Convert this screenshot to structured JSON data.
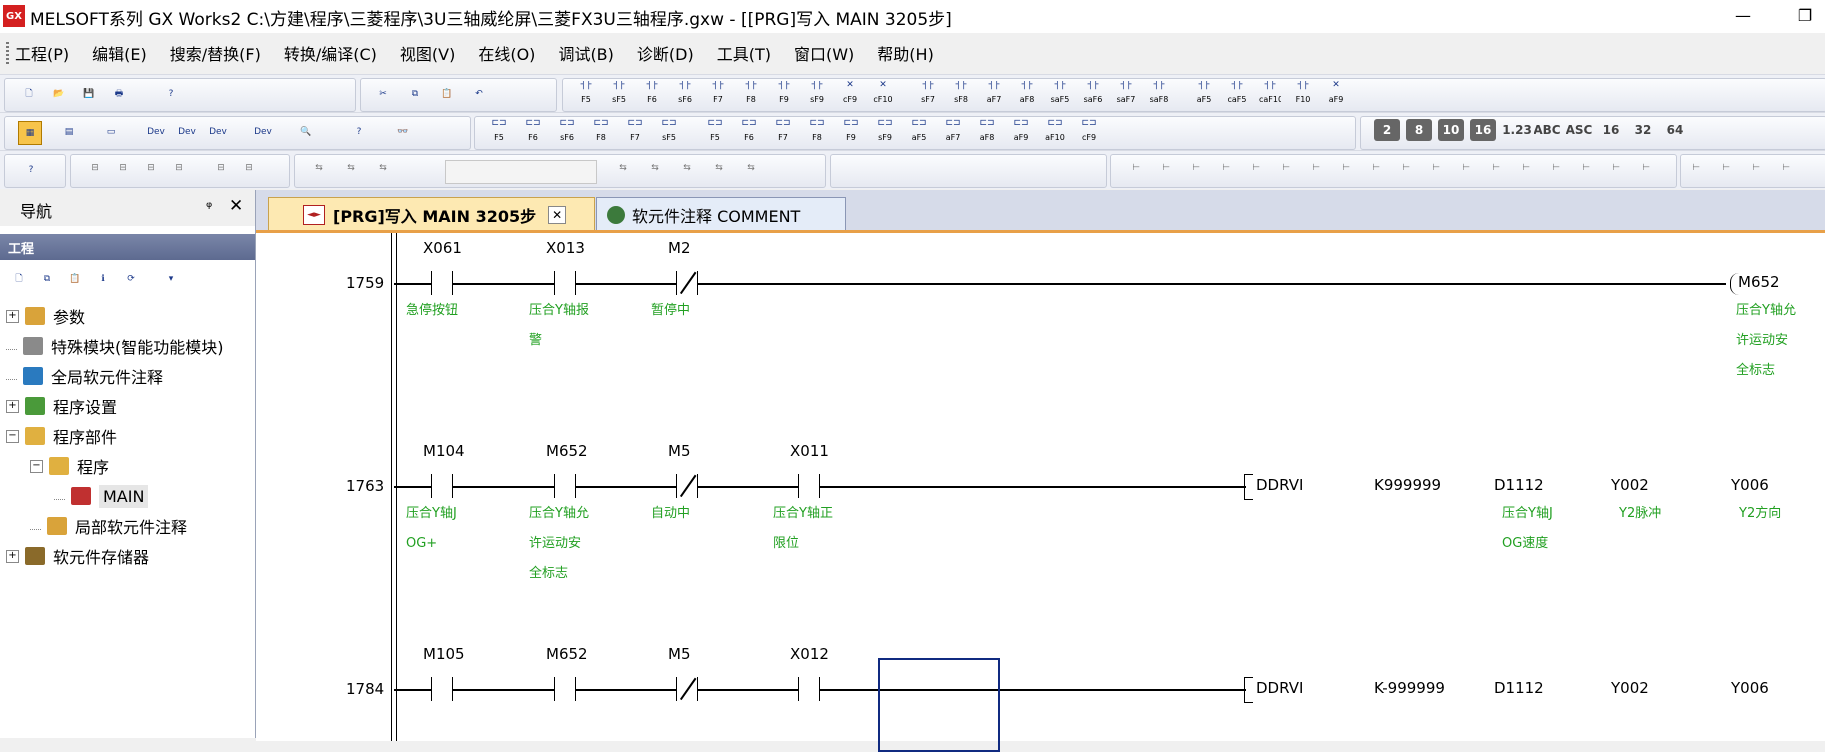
{
  "window": {
    "title": "MELSOFT系列 GX Works2 C:\\方建\\程序\\三菱程序\\3U三轴威纶屏\\三菱FX3U三轴程序.gxw - [[PRG]写入 MAIN 3205步]",
    "app_icon_text": "GX",
    "minimize": "—",
    "restore": "❐"
  },
  "menu": [
    "工程(P)",
    "编辑(E)",
    "搜索/替换(F)",
    "转换/编译(C)",
    "视图(V)",
    "在线(O)",
    "调试(B)",
    "诊断(D)",
    "工具(T)",
    "窗口(W)",
    "帮助(H)"
  ],
  "toolbar1_labels": [
    "F5",
    "sF5",
    "F6",
    "sF6",
    "F7",
    "F8",
    "F9",
    "sF9",
    "cF9",
    "cF10",
    "sF7",
    "sF8",
    "aF7",
    "aF8",
    "saF5",
    "saF6",
    "saF7",
    "saF8",
    "aF5",
    "caF5",
    "caF10",
    "F10",
    "aF9"
  ],
  "toolbar2_labels": [
    "F5",
    "F6",
    "sF6",
    "F8",
    "F7",
    "sF5",
    "F5",
    "F6",
    "F7",
    "F8",
    "F9",
    "sF9",
    "aF5",
    "aF7",
    "aF8",
    "aF9",
    "aF10",
    "cF9"
  ],
  "toolbar2_right": [
    "2",
    "8",
    "10",
    "16",
    "1.23",
    "ABC",
    "ASC",
    "16",
    "32",
    "64"
  ],
  "navigation": {
    "title": "导航",
    "pin": "ᵠ",
    "close": "✕",
    "section": "工程",
    "tree": [
      {
        "label": "参数",
        "expander": "+",
        "level": 0
      },
      {
        "label": "特殊模块(智能功能模块)",
        "expander": "",
        "level": 0
      },
      {
        "label": "全局软元件注释",
        "expander": "",
        "level": 0
      },
      {
        "label": "程序设置",
        "expander": "+",
        "level": 0
      },
      {
        "label": "程序部件",
        "expander": "−",
        "level": 0
      },
      {
        "label": "程序",
        "expander": "−",
        "level": 1
      },
      {
        "label": "MAIN",
        "expander": "",
        "level": 2
      },
      {
        "label": "局部软元件注释",
        "expander": "",
        "level": 1
      },
      {
        "label": "软元件存储器",
        "expander": "+",
        "level": 0
      }
    ]
  },
  "tabs": [
    {
      "label": "[PRG]写入 MAIN 3205步",
      "close": "✕",
      "active": true
    },
    {
      "label": "软元件注释 COMMENT",
      "active": false
    }
  ],
  "ladder": {
    "rung1": {
      "step": "1759",
      "contacts": [
        {
          "dev": "X061",
          "comment": [
            "急停按钮"
          ],
          "type": "no"
        },
        {
          "dev": "X013",
          "comment": [
            "压合Y轴报",
            "警"
          ],
          "type": "no"
        },
        {
          "dev": "M2",
          "comment": [
            "暂停中"
          ],
          "type": "nc"
        }
      ],
      "coil": {
        "dev": "M652",
        "comment": [
          "压合Y轴允",
          "许运动安",
          "全标志"
        ]
      }
    },
    "rung2": {
      "step": "1763",
      "contacts": [
        {
          "dev": "M104",
          "comment": [
            "压合Y轴J",
            "OG+"
          ],
          "type": "no"
        },
        {
          "dev": "M652",
          "comment": [
            "压合Y轴允",
            "许运动安",
            "全标志"
          ],
          "type": "no"
        },
        {
          "dev": "M5",
          "comment": [
            "自动中"
          ],
          "type": "nc"
        },
        {
          "dev": "X011",
          "comment": [
            "压合Y轴正",
            "限位"
          ],
          "type": "no"
        }
      ],
      "instruction": "DDRVI",
      "operands": [
        {
          "val": "K999999",
          "comment": []
        },
        {
          "val": "D1112",
          "comment": [
            "压合Y轴J",
            "OG速度"
          ]
        },
        {
          "val": "Y002",
          "comment": [
            "Y2脉冲"
          ]
        },
        {
          "val": "Y006",
          "comment": [
            "Y2方向"
          ]
        }
      ]
    },
    "rung3": {
      "step": "1784",
      "contacts": [
        {
          "dev": "M105",
          "type": "no"
        },
        {
          "dev": "M652",
          "type": "no"
        },
        {
          "dev": "M5",
          "type": "nc"
        },
        {
          "dev": "X012",
          "type": "no"
        }
      ],
      "instruction": "DDRVI",
      "operands": [
        "K-999999",
        "D1112",
        "Y002",
        "Y006"
      ]
    }
  }
}
